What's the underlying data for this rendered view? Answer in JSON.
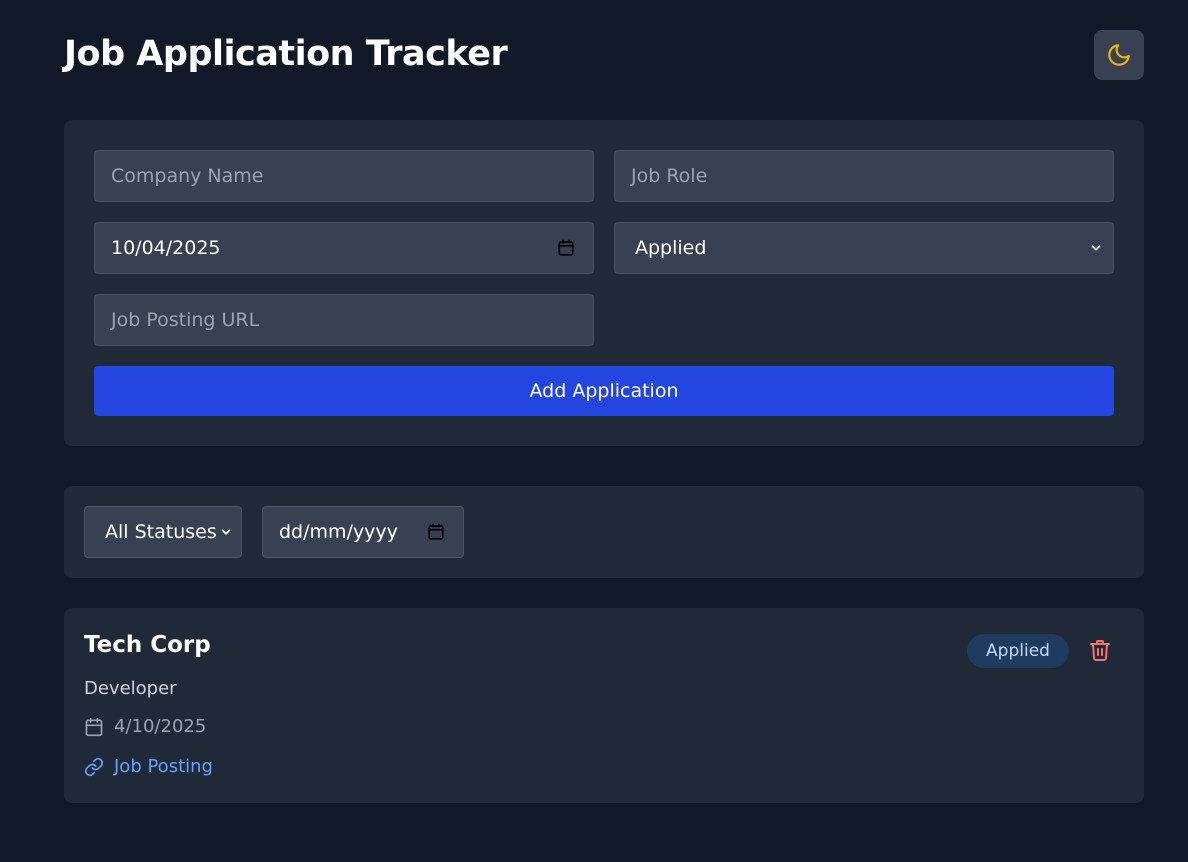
{
  "header": {
    "title": "Job Application Tracker",
    "theme_icon": "moon-icon"
  },
  "form": {
    "company_placeholder": "Company Name",
    "role_placeholder": "Job Role",
    "date_value": "10/04/2025",
    "status_value": "Applied",
    "url_placeholder": "Job Posting URL",
    "submit_label": "Add Application"
  },
  "filters": {
    "status_value": "All Statuses",
    "date_placeholder": "dd/mm/yyyy"
  },
  "applications": [
    {
      "company": "Tech Corp",
      "role": "Developer",
      "date": "4/10/2025",
      "link_label": "Job Posting",
      "status": "Applied"
    }
  ],
  "colors": {
    "background": "#111827",
    "card": "#1f2937",
    "input": "#374151",
    "accent": "#2346e0",
    "link": "#60a5fa",
    "badge_bg": "#1e3a5f",
    "badge_text": "#bfdbfe",
    "delete": "#f87171",
    "moon": "#eab308"
  }
}
